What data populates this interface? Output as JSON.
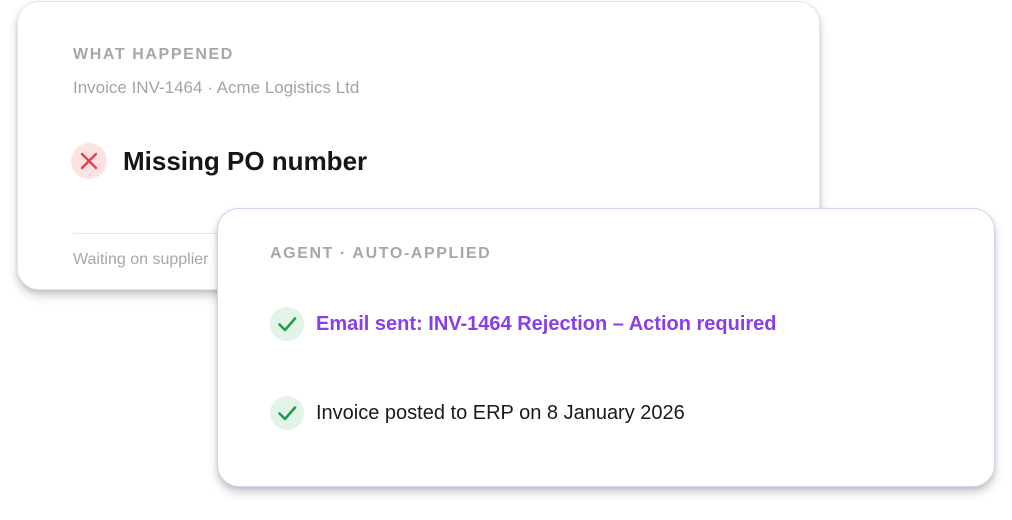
{
  "what_happened": {
    "eyebrow": "WHAT HAPPENED",
    "subtitle": "Invoice INV-1464 · Acme Logistics Ltd",
    "issue_icon": "x-icon",
    "issue_title": "Missing PO number",
    "footer": "Waiting on supplier"
  },
  "agent": {
    "eyebrow": "AGENT · AUTO-APPLIED",
    "actions": [
      {
        "icon": "check-icon",
        "label": "Email sent: INV-1464 Rejection – Action required",
        "is_link": true
      },
      {
        "icon": "check-icon",
        "label": "Invoice posted to ERP on 8 January 2026",
        "is_link": false
      }
    ]
  },
  "colors": {
    "error_red": "#e0434a",
    "error_bg": "#fbe3e4",
    "success_green": "#1f9d55",
    "success_bg": "#e2f3e8",
    "accent_purple": "#8a3ee8",
    "front_border": "#d8d0f3"
  }
}
